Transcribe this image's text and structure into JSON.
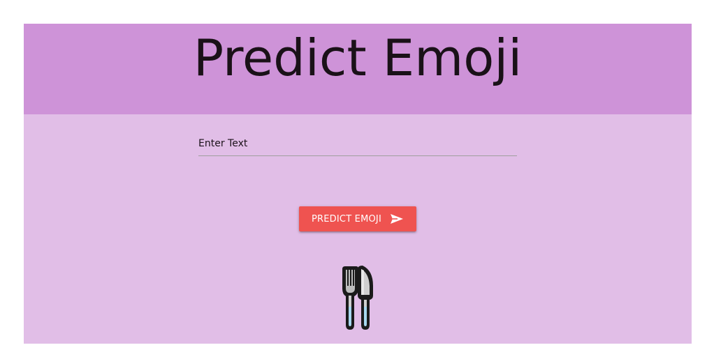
{
  "header": {
    "title": "Predict Emoji",
    "background_color": "#ce93d8"
  },
  "main": {
    "background_color": "#e1bee7",
    "text_input": {
      "placeholder": "Enter Text",
      "value": ""
    },
    "predict_button": {
      "label": "PREDICT EMOJI",
      "icon": "send-icon",
      "color": "#ef5350"
    },
    "result": {
      "emoji_name": "fork-and-knife-icon"
    }
  }
}
